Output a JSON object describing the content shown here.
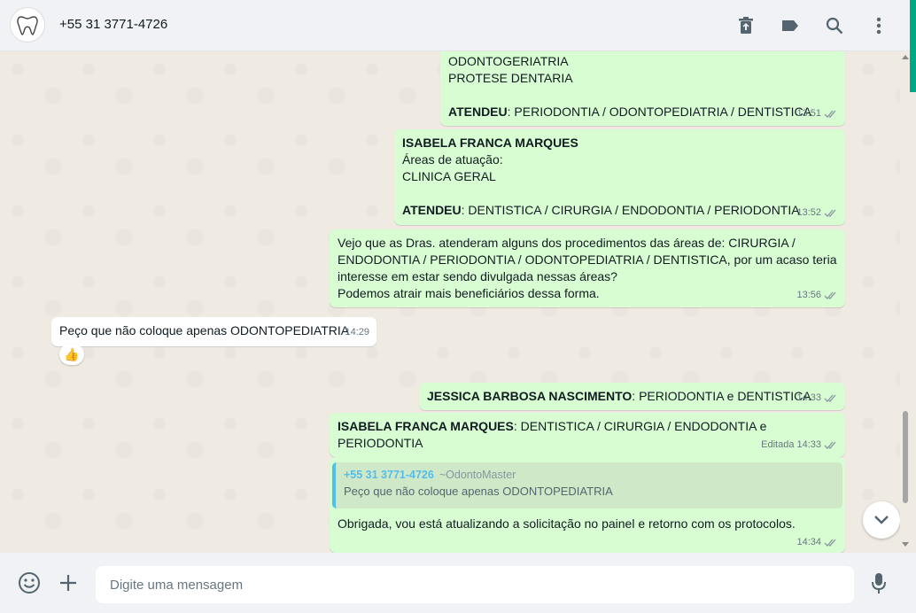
{
  "header": {
    "contact_name": "+55 31 3771-4726",
    "icons": [
      "avatar-tooth-icon",
      "delete-icon",
      "label-icon",
      "search-icon",
      "menu-icon"
    ]
  },
  "messages": [
    {
      "direction": "out",
      "lines": [
        "ODONTOGERIATRIA",
        "PROTESE DENTARIA",
        "",
        "ATENDEU: PERIODONTIA / ODONTOPEDIATRIA / DENTISTICA"
      ],
      "bold_prefix": "ATENDEU",
      "time": "13:51"
    },
    {
      "direction": "out",
      "title": "ISABELA FRANCA MARQUES",
      "lines": [
        "Áreas de atuação:",
        "CLINICA GERAL",
        ""
      ],
      "atendeu_label": "ATENDEU",
      "atendeu_value": ": DENTISTICA / CIRURGIA  /  ENDODONTIA  / PERIODONTIA",
      "time": "13:52"
    },
    {
      "direction": "out",
      "lines": [
        "Vejo que as Dras. atenderam alguns dos procedimentos das áreas de: CIRURGIA  /",
        "ENDODONTIA  / PERIODONTIA / ODONTOPEDIATRIA / DENTISTICA, por um acaso teria",
        "interesse em estar sendo divulgada nessas áreas?",
        "Podemos atrair mais beneficiários dessa forma."
      ],
      "time": "13:56"
    },
    {
      "direction": "in",
      "text": "Peço que não coloque apenas ODONTOPEDIATRIA",
      "time": "14:29",
      "reaction": "👍"
    },
    {
      "direction": "out",
      "bold": "JESSICA BARBOSA NASCIMENTO",
      "rest": ":  PERIODONTIA e DENTISTICA",
      "time": "14:33"
    },
    {
      "direction": "out",
      "bold": "ISABELA FRANCA MARQUES",
      "rest": ": DENTISTICA / CIRURGIA  /  ENDODONTIA  e",
      "line2": "PERIODONTIA",
      "edited": "Editada",
      "time": "14:33"
    },
    {
      "direction": "out",
      "quote_author": "+55 31 3771-4726",
      "quote_name": "~OdontoMaster",
      "quote_text": "Peço que não coloque apenas ODONTOPEDIATRIA",
      "text": "Obrigada, vou está atualizando a solicitação no painel e retorno com os protocolos.",
      "time": "14:34"
    }
  ],
  "footer": {
    "placeholder": "Digite uma mensagem",
    "icons": [
      "emoji-icon",
      "attach-plus-icon",
      "microphone-icon"
    ]
  },
  "colors": {
    "outgoing_bubble": "#d9fdd3",
    "incoming_bubble": "#ffffff",
    "chat_bg": "#efeae2",
    "header_bg": "#f0f2f5",
    "accent": "#00a884",
    "tick_read": "#8696a0"
  }
}
